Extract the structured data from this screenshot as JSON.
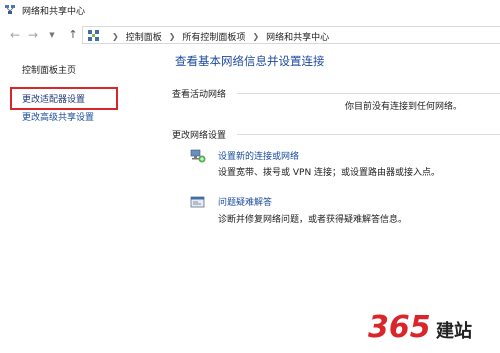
{
  "window": {
    "title": "网络和共享中心"
  },
  "addressbar": {
    "breadcrumbs": [
      "控制面板",
      "所有控制面板项",
      "网络和共享中心"
    ]
  },
  "sidebar": {
    "home": "控制面板主页",
    "items": [
      {
        "label": "更改适配器设置"
      },
      {
        "label": "更改高级共享设置"
      }
    ]
  },
  "main": {
    "title": "查看基本网络信息并设置连接",
    "active_networks": {
      "header": "查看活动网络",
      "status": "你目前没有连接到任何网络。"
    },
    "change_settings": {
      "header": "更改网络设置",
      "tasks": [
        {
          "icon": "network-setup-icon",
          "link": "设置新的连接或网络",
          "desc": "设置宽带、拨号或 VPN 连接；或设置路由器或接入点。"
        },
        {
          "icon": "troubleshoot-icon",
          "link": "问题疑难解答",
          "desc": "诊断并修复网络问题，或者获得疑难解答信息。"
        }
      ]
    }
  },
  "colors": {
    "link": "#1a4c9c",
    "title": "#1e4a9e",
    "highlight_box": "#d9262b",
    "watermark": "#d9262b"
  },
  "watermark": {
    "logo": "365建站"
  }
}
